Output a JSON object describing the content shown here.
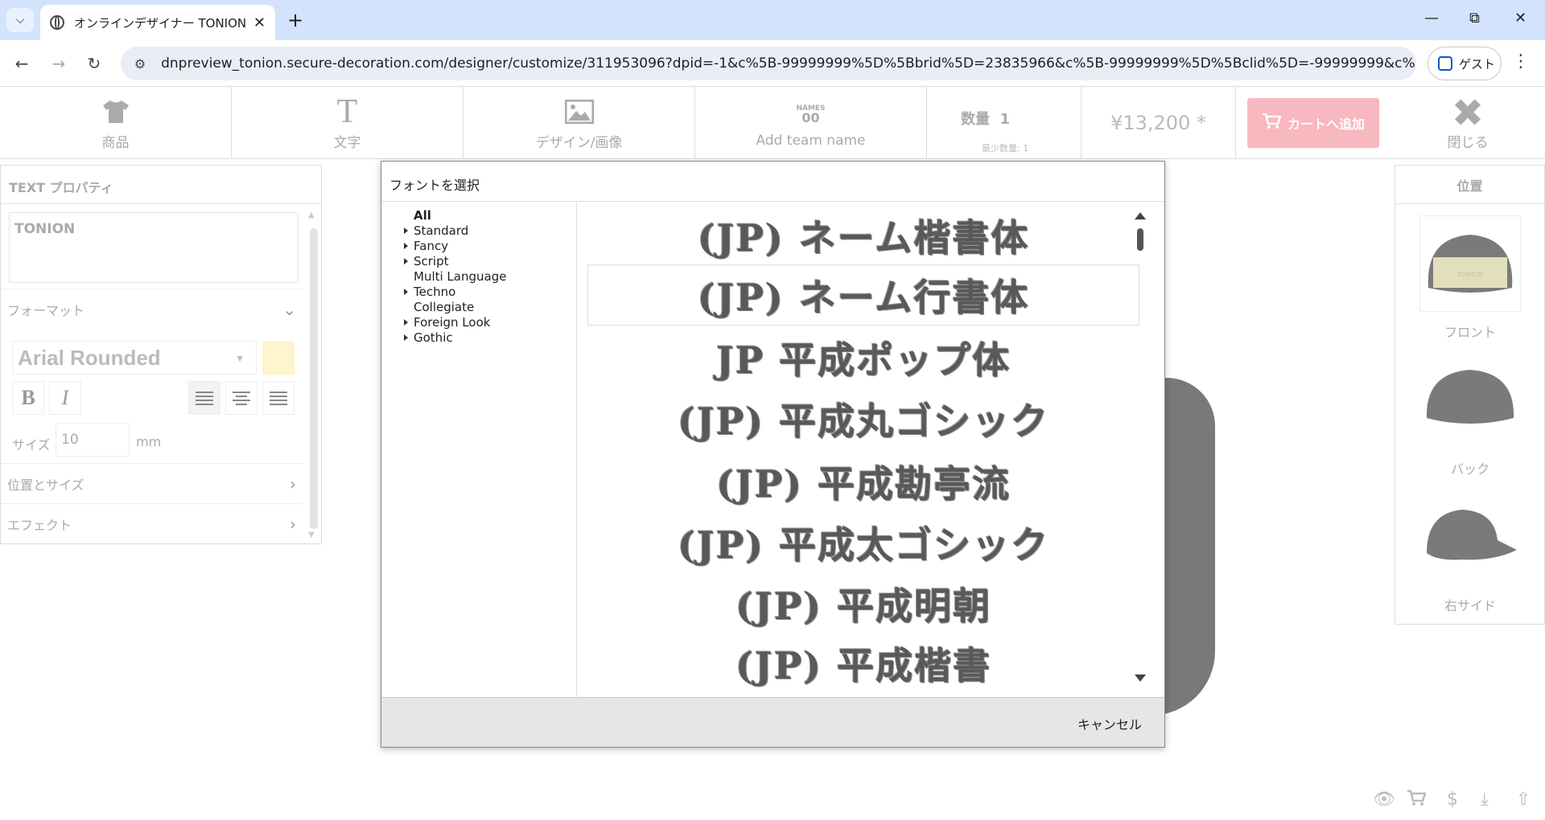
{
  "browser": {
    "tab_title": "オンラインデザイナー TONION",
    "url": "dnpreview_tonion.secure-decoration.com/designer/customize/311953096?dpid=-1&c%5B-99999999%5D%5Bbrid%5D=23835966&c%5B-99999999%5D%5Bclid%5D=-99999999&c%5B-99999999%...",
    "profile_label": "ゲスト"
  },
  "toolbar": {
    "product_label": "商品",
    "text_label": "文字",
    "design_label": "デザイン/画像",
    "team_label": "Add team name",
    "team_icon_top": "NAMES",
    "team_icon_num": "00",
    "quantity_label": "数量",
    "quantity_value": "1",
    "min_quantity": "最少数量: 1",
    "price": "¥13,200 *",
    "cart_label": "カートへ追加",
    "close_label": "閉じる"
  },
  "text_panel": {
    "header": "TEXT プロパティ",
    "text_value": "TONION",
    "format_label": "フォーマット",
    "font_name": "Arial Rounded",
    "bold_label": "B",
    "italic_label": "I",
    "size_label": "サイズ",
    "size_value": "10",
    "size_unit": "mm",
    "position_size_label": "位置とサイズ",
    "effect_label": "エフェクト",
    "color_swatch": "#fff5cc"
  },
  "position_panel": {
    "header": "位置",
    "views": [
      {
        "label": "フロント",
        "badge": "TONION"
      },
      {
        "label": "バック"
      },
      {
        "label": "右サイド"
      }
    ]
  },
  "font_dialog": {
    "title": "フォントを選択",
    "categories": [
      {
        "label": "All",
        "arrow": false,
        "selected": true
      },
      {
        "label": "Standard",
        "arrow": true
      },
      {
        "label": "Fancy",
        "arrow": true
      },
      {
        "label": "Script",
        "arrow": true
      },
      {
        "label": "Multi Language",
        "arrow": false
      },
      {
        "label": "Techno",
        "arrow": true
      },
      {
        "label": "Collegiate",
        "arrow": false
      },
      {
        "label": "Foreign Look",
        "arrow": true
      },
      {
        "label": "Gothic",
        "arrow": true
      }
    ],
    "fonts": [
      {
        "sample": "(JP) ネーム楷書体",
        "selected": false
      },
      {
        "sample": "(JP) ネーム行書体",
        "selected": true
      },
      {
        "sample": "JP 平成ポップ体",
        "selected": false
      },
      {
        "sample": "(JP) 平成丸ゴシック",
        "selected": false
      },
      {
        "sample": "(JP) 平成勘亭流",
        "selected": false
      },
      {
        "sample": "(JP) 平成太ゴシック",
        "selected": false
      },
      {
        "sample": "(JP) 平成明朝",
        "selected": false
      },
      {
        "sample": "(JP) 平成楷書",
        "selected": false
      }
    ],
    "cancel_label": "キャンセル"
  }
}
